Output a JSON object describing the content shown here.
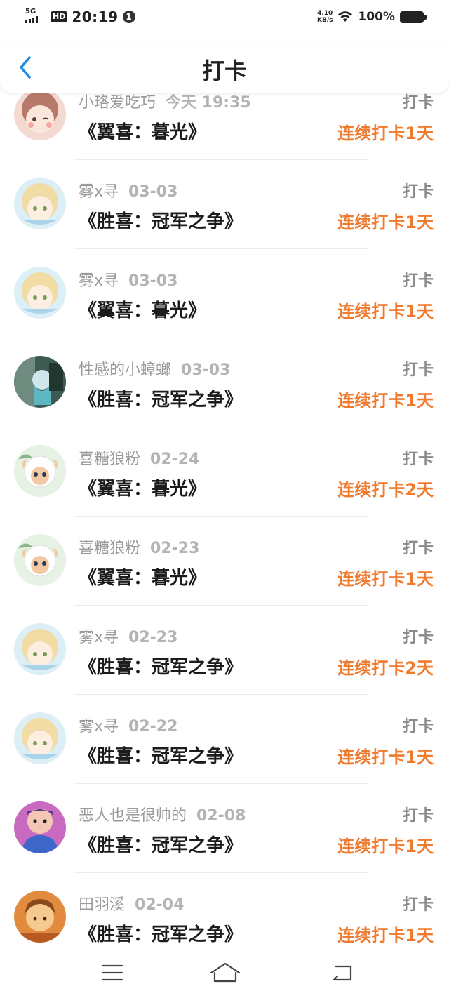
{
  "status_bar": {
    "network": "5G",
    "hd": "HD",
    "time": "20:19",
    "notification_count": "1",
    "speed_value": "4.10",
    "speed_unit": "KB/s",
    "battery": "100%"
  },
  "header": {
    "title": "打卡",
    "back_icon": "chevron-left-icon"
  },
  "colors": {
    "accent": "#f07a2e",
    "back": "#1e88e5"
  },
  "entries": [
    {
      "user": "小珞爱吃巧",
      "date": "今天 19:35",
      "book": "《翼喜：暮光》",
      "action": "打卡",
      "streak": "连续打卡1天",
      "avatar": "a"
    },
    {
      "user": "雾x寻",
      "date": "03-03",
      "book": "《胜喜：冠军之争》",
      "action": "打卡",
      "streak": "连续打卡1天",
      "avatar": "b"
    },
    {
      "user": "雾x寻",
      "date": "03-03",
      "book": "《翼喜：暮光》",
      "action": "打卡",
      "streak": "连续打卡1天",
      "avatar": "b"
    },
    {
      "user": "性感的小蟑螂",
      "date": "03-03",
      "book": "《胜喜：冠军之争》",
      "action": "打卡",
      "streak": "连续打卡1天",
      "avatar": "c"
    },
    {
      "user": "喜糖狼粉",
      "date": "02-24",
      "book": "《翼喜：暮光》",
      "action": "打卡",
      "streak": "连续打卡2天",
      "avatar": "d"
    },
    {
      "user": "喜糖狼粉",
      "date": "02-23",
      "book": "《翼喜：暮光》",
      "action": "打卡",
      "streak": "连续打卡1天",
      "avatar": "d"
    },
    {
      "user": "雾x寻",
      "date": "02-23",
      "book": "《胜喜：冠军之争》",
      "action": "打卡",
      "streak": "连续打卡2天",
      "avatar": "b"
    },
    {
      "user": "雾x寻",
      "date": "02-22",
      "book": "《胜喜：冠军之争》",
      "action": "打卡",
      "streak": "连续打卡1天",
      "avatar": "b"
    },
    {
      "user": "恶人也是很帅的",
      "date": "02-08",
      "book": "《胜喜：冠军之争》",
      "action": "打卡",
      "streak": "连续打卡1天",
      "avatar": "e"
    },
    {
      "user": "田羽溪",
      "date": "02-04",
      "book": "《胜喜：冠军之争》",
      "action": "打卡",
      "streak": "连续打卡1天",
      "avatar": "f"
    }
  ],
  "nav": {
    "menu_icon": "menu-icon",
    "home_icon": "home-icon",
    "back_icon": "back-icon"
  }
}
